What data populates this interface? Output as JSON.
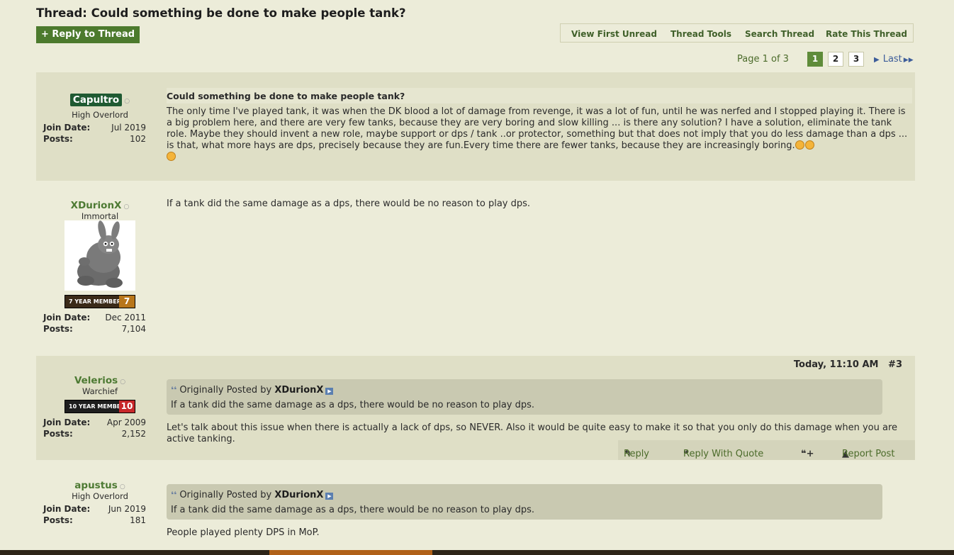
{
  "thread": {
    "title": "Thread: Could something be done to make people tank?",
    "reply_button": "+ Reply to Thread"
  },
  "tools": {
    "view_first_unread": "View First Unread",
    "thread_tools": "Thread Tools",
    "search_thread": "Search Thread",
    "rate_thread": "Rate This Thread"
  },
  "pagination": {
    "label": "Page 1 of 3",
    "pages": [
      "1",
      "2",
      "3"
    ],
    "current": "1",
    "last": "Last"
  },
  "posts": [
    {
      "username": "Capultro",
      "user_title": "High Overlord",
      "join_label": "Join Date:",
      "join_date": "Jul 2019",
      "posts_label": "Posts:",
      "post_count": "102",
      "title": "Could something be done to make people tank?",
      "body": "The only time I've played tank, it was when the DK blood a lot of damage from revenge, it was a lot of fun, until he was nerfed and I stopped playing it. There is a big problem here, and there are very few tanks, because they are very boring and slow killing ... is there any solution? I have a solution, eliminate the tank role. Maybe they should invent a new role, maybe support or dps / tank ..or protector, something but that does not imply that you do less damage than a dps ... is that, what more hays are dps, precisely because they are fun.Every time there are fewer tanks, because they are increasingly boring."
    },
    {
      "username": "XDurionX",
      "user_title": "Immortal",
      "badge_text": "7 YEAR MEMBER",
      "badge_number": "7",
      "join_label": "Join Date:",
      "join_date": "Dec 2011",
      "posts_label": "Posts:",
      "post_count": "7,104",
      "body": "If a tank did the same damage as a dps, there would be no reason to play dps."
    },
    {
      "username": "Velerios",
      "user_title": "Warchief",
      "badge_text": "10 YEAR MEMBER",
      "badge_number": "10",
      "join_label": "Join Date:",
      "join_date": "Apr 2009",
      "posts_label": "Posts:",
      "post_count": "2,152",
      "date": "Today, 11:10 AM",
      "post_number": "#3",
      "quote_prefix": "Originally Posted by",
      "quote_author": "XDurionX",
      "quote_text": "If a tank did the same damage as a dps, there would be no reason to play dps.",
      "body": "Let's talk about this issue when there is actually a lack of dps, so NEVER. Also it would be quite easy to make it so that you only do this damage when you are active tanking.",
      "actions": {
        "reply": "Reply",
        "reply_quote": "Reply With Quote",
        "report": "Report Post"
      }
    },
    {
      "username": "apustus",
      "user_title": "High Overlord",
      "join_label": "Join Date:",
      "join_date": "Jun 2019",
      "posts_label": "Posts:",
      "post_count": "181",
      "quote_prefix": "Originally Posted by",
      "quote_author": "XDurionX",
      "quote_text": "If a tank did the same damage as a dps, there would be no reason to play dps.",
      "body": "People played plenty DPS in MoP."
    }
  ],
  "colors": {
    "background": "#ececd9",
    "post_shade": "#dfdfc6",
    "accent_green": "#4c7a2d",
    "username_green": "#4d7a33",
    "quote_bg": "#c9c9b1",
    "badge_7": "#b8761a",
    "badge_10": "#c8282a"
  }
}
